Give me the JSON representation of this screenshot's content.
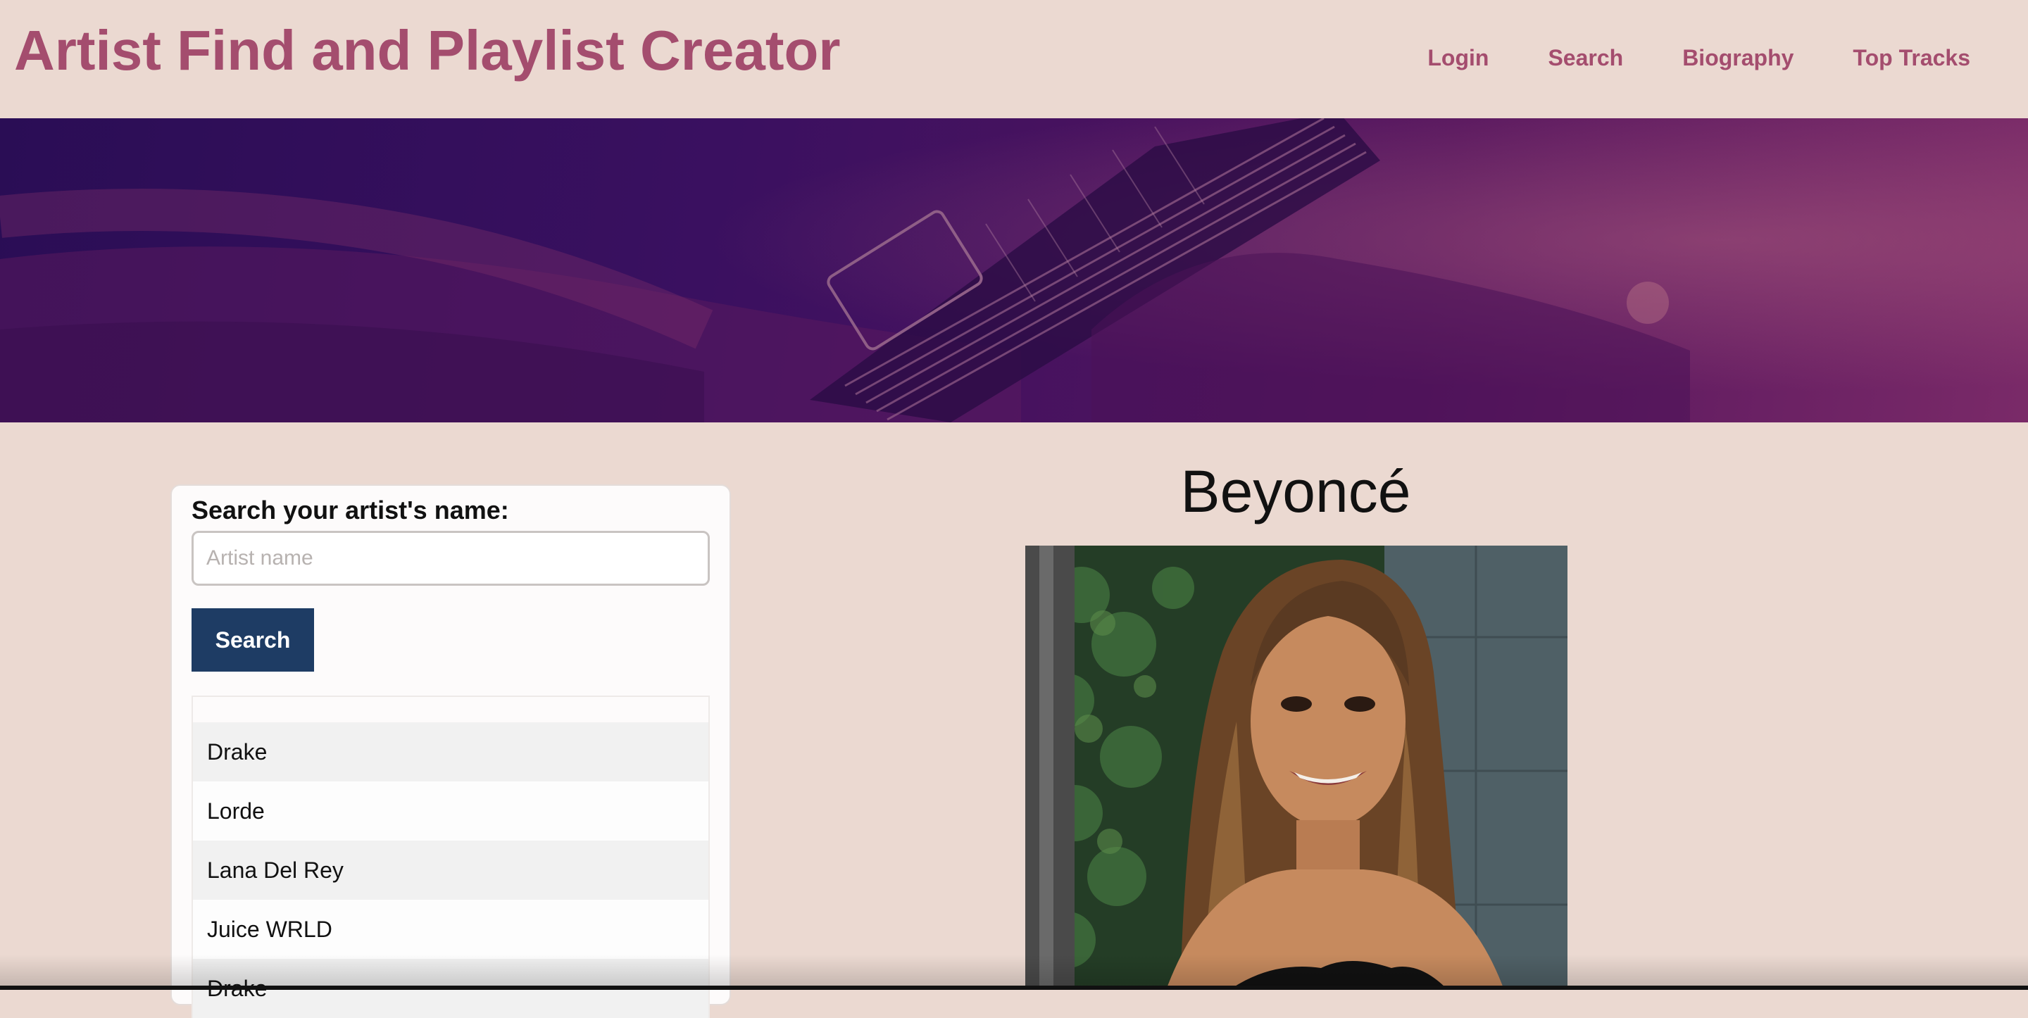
{
  "app": {
    "title": "Artist Find and Playlist Creator"
  },
  "nav": {
    "items": [
      "Login",
      "Search",
      "Biography",
      "Top Tracks"
    ]
  },
  "search": {
    "label": "Search your artist's name:",
    "placeholder": "Artist name",
    "value": "",
    "button_label": "Search"
  },
  "results": [
    "Drake",
    "Lorde",
    "Lana Del Rey",
    "Juice WRLD",
    "Drake"
  ],
  "artist": {
    "name": "Beyoncé"
  },
  "colors": {
    "accent": "#a44d6e",
    "button": "#1e3c64",
    "background": "#ebd9d1"
  },
  "icons": {
    "hero": "guitar-hero-image",
    "artist_photo": "artist-photo-image"
  }
}
